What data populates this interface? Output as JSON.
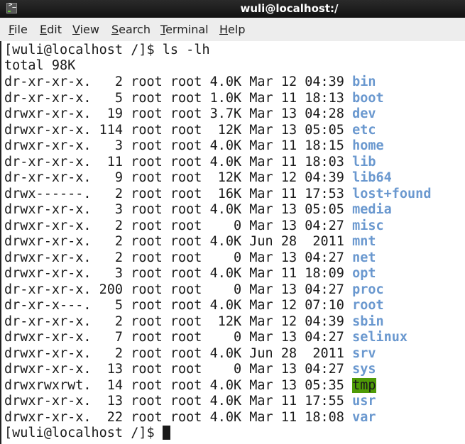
{
  "window": {
    "title": "wuli@localhost:/",
    "icon": "terminal-icon"
  },
  "menubar": {
    "items": [
      {
        "label": "File",
        "mnemonic": "F",
        "rest": "ile"
      },
      {
        "label": "Edit",
        "mnemonic": "E",
        "rest": "dit"
      },
      {
        "label": "View",
        "mnemonic": "V",
        "rest": "iew"
      },
      {
        "label": "Search",
        "mnemonic": "S",
        "rest": "earch"
      },
      {
        "label": "Terminal",
        "mnemonic": "T",
        "rest": "erminal"
      },
      {
        "label": "Help",
        "mnemonic": "H",
        "rest": "elp"
      }
    ]
  },
  "terminal": {
    "prompt": "[wuli@localhost /]$ ",
    "command": "ls -lh",
    "total": "total 98K",
    "colors": {
      "directory": "#6a98cf",
      "sticky_bg": "#4e9a06",
      "text": "#1a1a1a"
    },
    "entries": [
      {
        "perms": "dr-xr-xr-x.",
        "links": "2",
        "owner": "root",
        "group": "root",
        "size": "4.0K",
        "month": "Mar",
        "day": "12",
        "time": "04:39",
        "name": "bin"
      },
      {
        "perms": "dr-xr-xr-x.",
        "links": "5",
        "owner": "root",
        "group": "root",
        "size": "1.0K",
        "month": "Mar",
        "day": "11",
        "time": "18:13",
        "name": "boot"
      },
      {
        "perms": "drwxr-xr-x.",
        "links": "19",
        "owner": "root",
        "group": "root",
        "size": "3.7K",
        "month": "Mar",
        "day": "13",
        "time": "04:28",
        "name": "dev"
      },
      {
        "perms": "drwxr-xr-x.",
        "links": "114",
        "owner": "root",
        "group": "root",
        "size": "12K",
        "month": "Mar",
        "day": "13",
        "time": "05:05",
        "name": "etc"
      },
      {
        "perms": "drwxr-xr-x.",
        "links": "3",
        "owner": "root",
        "group": "root",
        "size": "4.0K",
        "month": "Mar",
        "day": "11",
        "time": "18:15",
        "name": "home"
      },
      {
        "perms": "dr-xr-xr-x.",
        "links": "11",
        "owner": "root",
        "group": "root",
        "size": "4.0K",
        "month": "Mar",
        "day": "11",
        "time": "18:03",
        "name": "lib"
      },
      {
        "perms": "dr-xr-xr-x.",
        "links": "9",
        "owner": "root",
        "group": "root",
        "size": "12K",
        "month": "Mar",
        "day": "12",
        "time": "04:39",
        "name": "lib64"
      },
      {
        "perms": "drwx------.",
        "links": "2",
        "owner": "root",
        "group": "root",
        "size": "16K",
        "month": "Mar",
        "day": "11",
        "time": "17:53",
        "name": "lost+found"
      },
      {
        "perms": "drwxr-xr-x.",
        "links": "3",
        "owner": "root",
        "group": "root",
        "size": "4.0K",
        "month": "Mar",
        "day": "13",
        "time": "05:05",
        "name": "media"
      },
      {
        "perms": "drwxr-xr-x.",
        "links": "2",
        "owner": "root",
        "group": "root",
        "size": "0",
        "month": "Mar",
        "day": "13",
        "time": "04:27",
        "name": "misc"
      },
      {
        "perms": "drwxr-xr-x.",
        "links": "2",
        "owner": "root",
        "group": "root",
        "size": "4.0K",
        "month": "Jun",
        "day": "28",
        "time": "2011",
        "name": "mnt"
      },
      {
        "perms": "drwxr-xr-x.",
        "links": "2",
        "owner": "root",
        "group": "root",
        "size": "0",
        "month": "Mar",
        "day": "13",
        "time": "04:27",
        "name": "net"
      },
      {
        "perms": "drwxr-xr-x.",
        "links": "3",
        "owner": "root",
        "group": "root",
        "size": "4.0K",
        "month": "Mar",
        "day": "11",
        "time": "18:09",
        "name": "opt"
      },
      {
        "perms": "dr-xr-xr-x.",
        "links": "200",
        "owner": "root",
        "group": "root",
        "size": "0",
        "month": "Mar",
        "day": "13",
        "time": "04:27",
        "name": "proc"
      },
      {
        "perms": "dr-xr-x---.",
        "links": "5",
        "owner": "root",
        "group": "root",
        "size": "4.0K",
        "month": "Mar",
        "day": "12",
        "time": "07:10",
        "name": "root"
      },
      {
        "perms": "dr-xr-xr-x.",
        "links": "2",
        "owner": "root",
        "group": "root",
        "size": "12K",
        "month": "Mar",
        "day": "12",
        "time": "04:39",
        "name": "sbin"
      },
      {
        "perms": "drwxr-xr-x.",
        "links": "7",
        "owner": "root",
        "group": "root",
        "size": "0",
        "month": "Mar",
        "day": "13",
        "time": "04:27",
        "name": "selinux"
      },
      {
        "perms": "drwxr-xr-x.",
        "links": "2",
        "owner": "root",
        "group": "root",
        "size": "4.0K",
        "month": "Jun",
        "day": "28",
        "time": "2011",
        "name": "srv"
      },
      {
        "perms": "drwxr-xr-x.",
        "links": "13",
        "owner": "root",
        "group": "root",
        "size": "0",
        "month": "Mar",
        "day": "13",
        "time": "04:27",
        "name": "sys"
      },
      {
        "perms": "drwxrwxrwt.",
        "links": "14",
        "owner": "root",
        "group": "root",
        "size": "4.0K",
        "month": "Mar",
        "day": "13",
        "time": "05:35",
        "name": "tmp",
        "sticky": true
      },
      {
        "perms": "drwxr-xr-x.",
        "links": "13",
        "owner": "root",
        "group": "root",
        "size": "4.0K",
        "month": "Mar",
        "day": "11",
        "time": "17:55",
        "name": "usr"
      },
      {
        "perms": "drwxr-xr-x.",
        "links": "22",
        "owner": "root",
        "group": "root",
        "size": "4.0K",
        "month": "Mar",
        "day": "11",
        "time": "18:08",
        "name": "var"
      }
    ]
  }
}
